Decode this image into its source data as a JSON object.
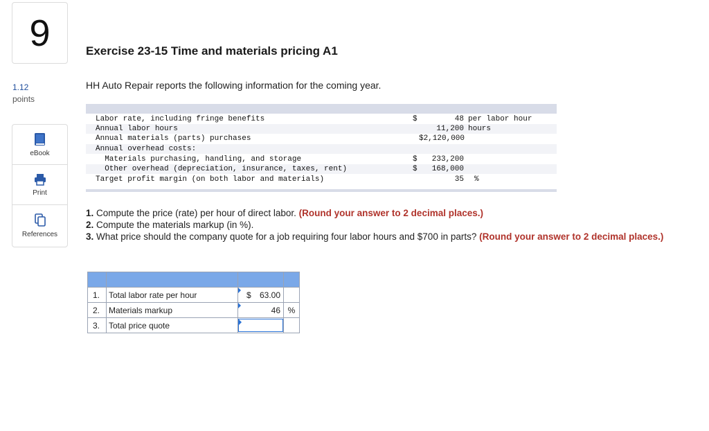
{
  "question": {
    "number": "9",
    "points_value": "1.12",
    "points_label": "points"
  },
  "tools": [
    {
      "label": "eBook",
      "icon": "book-icon"
    },
    {
      "label": "Print",
      "icon": "printer-icon"
    },
    {
      "label": "References",
      "icon": "references-icon"
    }
  ],
  "title": "Exercise 23-15 Time and materials pricing A1",
  "intro": "HH Auto Repair reports the following information for the coming year.",
  "info_rows": [
    {
      "label": "Labor rate, including fringe benefits",
      "currency": "$",
      "amount": "48",
      "unit": "per labor hour"
    },
    {
      "label": "Annual labor hours",
      "currency": "",
      "amount": "11,200",
      "unit": "hours"
    },
    {
      "label": "Annual materials (parts) purchases",
      "currency": "",
      "amount": "$2,120,000",
      "unit": ""
    },
    {
      "label": "Annual overhead costs:",
      "currency": "",
      "amount": "",
      "unit": ""
    },
    {
      "label": "  Materials purchasing, handling, and storage",
      "currency": "$",
      "amount": "233,200",
      "unit": ""
    },
    {
      "label": "  Other overhead (depreciation, insurance, taxes, rent)",
      "currency": "$",
      "amount": "168,000",
      "unit": ""
    },
    {
      "label": "Target profit margin (on both labor and materials)",
      "currency": "",
      "amount": "35",
      "unit": "%"
    }
  ],
  "questions": [
    {
      "num": "1.",
      "text": " Compute the price (rate) per hour of direct labor. ",
      "note": "(Round your answer to 2 decimal places.)"
    },
    {
      "num": "2.",
      "text": " Compute the materials markup (in %).",
      "note": ""
    },
    {
      "num": "3.",
      "text": " What price should the company quote for a job requiring four labor hours and $700 in parts? ",
      "note": "(Round your answer to 2 decimal places.)"
    }
  ],
  "answers": [
    {
      "num": "1.",
      "label": "Total labor rate per hour",
      "prefix": "$",
      "value": "63.00",
      "suffix": ""
    },
    {
      "num": "2.",
      "label": "Materials markup",
      "prefix": "",
      "value": "46",
      "suffix": "%"
    },
    {
      "num": "3.",
      "label": "Total price quote",
      "prefix": "",
      "value": "",
      "suffix": ""
    }
  ],
  "colors": {
    "header_blue": "#7aa8e8",
    "accent_red": "#b0332b",
    "input_border": "#2b73d6",
    "points_blue": "#1f4e9c"
  }
}
